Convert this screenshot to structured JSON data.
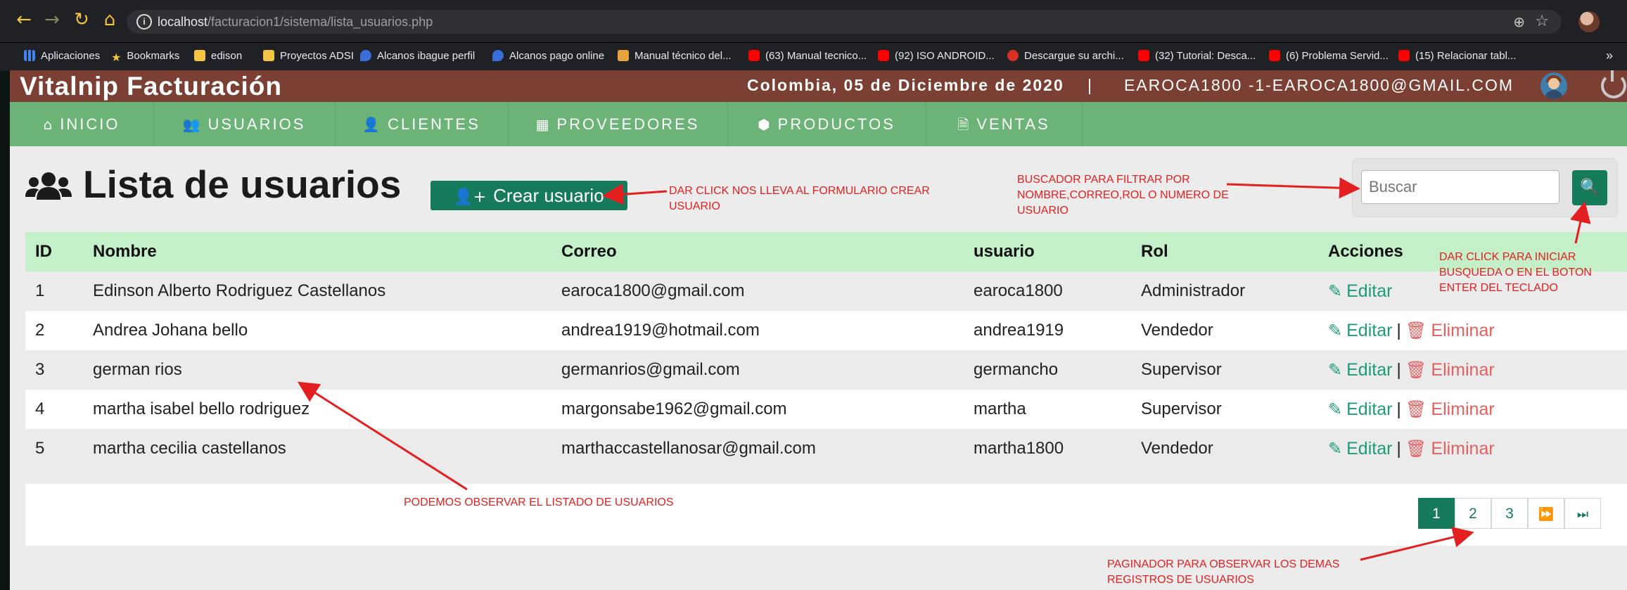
{
  "browser": {
    "url_host": "localhost",
    "url_path": "/facturacion1/sistema/lista_usuarios.php",
    "bookmarks": [
      {
        "label": "Aplicaciones",
        "icon": "apps-icon"
      },
      {
        "label": "Bookmarks",
        "icon": "star-icon"
      },
      {
        "label": "edison",
        "icon": "folder-icon"
      },
      {
        "label": "Proyectos ADSI",
        "icon": "folder-icon"
      },
      {
        "label": "Alcanos ibague perfil",
        "icon": "flame-icon"
      },
      {
        "label": "Alcanos pago online",
        "icon": "flame-icon"
      },
      {
        "label": "Manual técnico del...",
        "icon": "shield-icon"
      },
      {
        "label": "(63) Manual tecnico...",
        "icon": "youtube-icon"
      },
      {
        "label": "(92) ISO ANDROID...",
        "icon": "youtube-icon"
      },
      {
        "label": "Descargue su archi...",
        "icon": "doc-icon"
      },
      {
        "label": "(32) Tutorial: Desca...",
        "icon": "youtube-icon"
      },
      {
        "label": "(6) Problema Servid...",
        "icon": "youtube-icon"
      },
      {
        "label": "(15) Relacionar tabl...",
        "icon": "youtube-icon"
      }
    ],
    "bookmarks_more": "»"
  },
  "header": {
    "title": "Vitalnip Facturación",
    "date": "Colombia, 05 de Diciembre de 2020",
    "separator": "|",
    "user": "EAROCA1800 -1-EAROCA1800@GMAIL.COM"
  },
  "menu": [
    {
      "label": "INICIO",
      "icon": "home-icon"
    },
    {
      "label": "USUARIOS",
      "icon": "users-icon"
    },
    {
      "label": "CLIENTES",
      "icon": "user-icon"
    },
    {
      "label": "PROVEEDORES",
      "icon": "building-icon"
    },
    {
      "label": "PRODUCTOS",
      "icon": "cubes-icon"
    },
    {
      "label": "VENTAS",
      "icon": "file-icon"
    }
  ],
  "page": {
    "title": "Lista de usuarios",
    "create_button": "Crear usuario",
    "search_placeholder": "Buscar"
  },
  "table": {
    "headers": [
      "ID",
      "Nombre",
      "Correo",
      "usuario",
      "Rol",
      "Acciones"
    ],
    "rows": [
      {
        "id": "1",
        "nombre": "Edinson Alberto Rodriguez Castellanos",
        "correo": "earoca1800@gmail.com",
        "usuario": "earoca1800",
        "rol": "Administrador"
      },
      {
        "id": "2",
        "nombre": "Andrea Johana bello",
        "correo": "andrea1919@hotmail.com",
        "usuario": "andrea1919",
        "rol": "Vendedor"
      },
      {
        "id": "3",
        "nombre": "german rios",
        "correo": "germanrios@gmail.com",
        "usuario": "germancho",
        "rol": "Supervisor"
      },
      {
        "id": "4",
        "nombre": "martha isabel bello rodriguez",
        "correo": "margonsabe1962@gmail.com",
        "usuario": "martha",
        "rol": "Supervisor"
      },
      {
        "id": "5",
        "nombre": "martha cecilia castellanos",
        "correo": "marthaccastellanosar@gmail.com",
        "usuario": "martha1800",
        "rol": "Vendedor"
      }
    ],
    "edit_label": "Editar",
    "delete_label": "Eliminar",
    "action_separator": "|"
  },
  "pagination": {
    "pages": [
      "1",
      "2",
      "3"
    ],
    "active_page": "1"
  },
  "annotations": {
    "create": "DAR CLICK NOS LLEVA AL FORMULARIO CREAR\nUSUARIO",
    "search": "BUSCADOR PARA FILTRAR POR\nNOMBRE,CORREO,ROL O NUMERO DE\nUSUARIO",
    "search_btn": "DAR CLICK PARA INICIAR\nBUSQUEDA O EN EL BOTON\nENTER DEL TECLADO",
    "list": "PODEMOS OBSERVAR EL LISTADO DE USUARIOS",
    "pager": "PAGINADOR PARA OBSERVAR LOS DEMAS\nREGISTROS DE USUARIOS"
  },
  "colors": {
    "header_bg": "#7b3f33",
    "menu_bg": "#6cb377",
    "accent": "#167a5c",
    "table_head": "#c3f0c8",
    "edit": "#1e9b7a",
    "delete": "#e26060",
    "annotation": "#e41f1f"
  }
}
